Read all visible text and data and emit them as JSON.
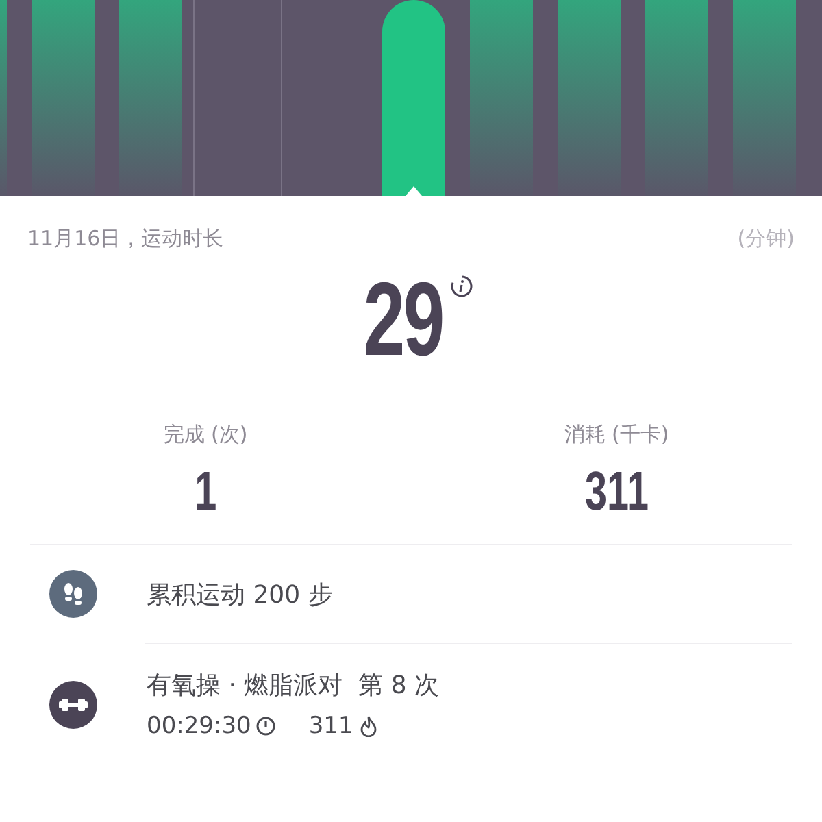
{
  "chart_bars": [
    {
      "kind": "bar",
      "selected": false
    },
    {
      "kind": "bar",
      "selected": false
    },
    {
      "kind": "bar",
      "selected": false
    },
    {
      "kind": "empty",
      "selected": false
    },
    {
      "kind": "empty",
      "selected": false
    },
    {
      "kind": "bar",
      "selected": true
    },
    {
      "kind": "bar",
      "selected": false
    },
    {
      "kind": "bar",
      "selected": false
    },
    {
      "kind": "bar",
      "selected": false
    },
    {
      "kind": "bar",
      "selected": false
    }
  ],
  "summary": {
    "date_label": "11月16日，运动时长",
    "unit": "(分钟)",
    "value": "29"
  },
  "stats": [
    {
      "label": "完成 (次)",
      "value": "1"
    },
    {
      "label": "消耗 (千卡)",
      "value": "311"
    }
  ],
  "records": [
    {
      "kind": "steps",
      "title": "累积运动 200 步"
    },
    {
      "kind": "workout",
      "title": "有氧操 · 燃脂派对  第 8 次",
      "duration": "00:29:30",
      "calories": "311"
    }
  ]
}
